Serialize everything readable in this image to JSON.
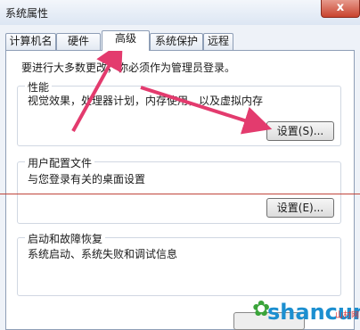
{
  "window": {
    "title": "系统属性",
    "close_label": "x"
  },
  "tabs": [
    {
      "label": "计算机名",
      "active": false
    },
    {
      "label": "硬件",
      "active": false
    },
    {
      "label": "高级",
      "active": true
    },
    {
      "label": "系统保护",
      "active": false
    },
    {
      "label": "远程",
      "active": false
    }
  ],
  "admin_note": "要进行大多数更改，你必须作为管理员登录。",
  "performance": {
    "label": "性能",
    "description": "视觉效果，处理器计划，内存使用，以及虚拟内存",
    "settings_button": "设置(S)..."
  },
  "user_profiles": {
    "label": "用户配置文件",
    "description": "与您登录有关的桌面设置",
    "settings_button": "设置(E)..."
  },
  "startup_recovery": {
    "label": "启动和故障恢复",
    "description": "系统启动、系统失败和调试信息"
  },
  "watermark": {
    "text": "shancun",
    "sub": "山村网"
  },
  "colors": {
    "arrow": "#e33b6e",
    "accent_line": "#c0463b"
  }
}
